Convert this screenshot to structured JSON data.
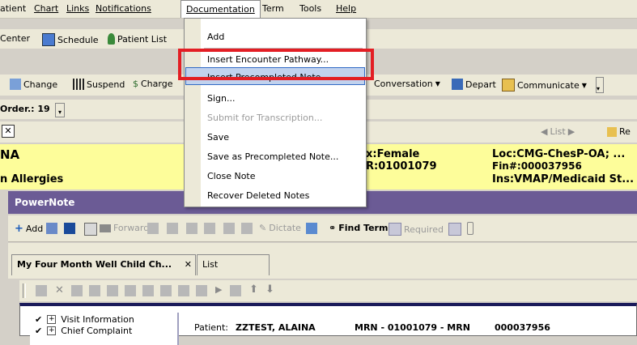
{
  "menubar": {
    "items": [
      "atient",
      "Chart",
      "Links",
      "Notifications",
      "Documentation",
      "Term",
      "Tools",
      "Help"
    ]
  },
  "toolbar1": {
    "center": "Center",
    "schedule": "Schedule",
    "patient_list": "Patient List"
  },
  "toolbar2": {
    "change": "Change",
    "suspend": "Suspend",
    "charges": "Charge",
    "conversation": "Conversation",
    "depart": "Depart",
    "communicate": "Communicate",
    "drop_arrow": "▾"
  },
  "order": {
    "label": "Order.: 19"
  },
  "nav": {
    "close": "✕",
    "list": "List",
    "re": "Re"
  },
  "banner": {
    "name": "NA",
    "allergies": "n Allergies",
    "sex": "x:Female",
    "mrn": "R:01001079",
    "loc": "Loc:CMG-ChesP-OA; ...",
    "fin": "Fin#:000037956",
    "ins": "Ins:VMAP/Medicaid St..."
  },
  "powernote": {
    "title": "PowerNote"
  },
  "pn_toolbar": {
    "add": "Add",
    "forward": "Forward",
    "dictate": "Dictate",
    "find_term": "Find Term",
    "required": "Required"
  },
  "tabs": [
    {
      "label": "My Four Month Well Child Ch...",
      "close": "✕"
    },
    {
      "label": "List"
    }
  ],
  "tree": {
    "items": [
      "Visit Information",
      "Chief Complaint"
    ]
  },
  "note_header": {
    "patient_label": "Patient:",
    "patient_name": "ZZTEST, ALAINA",
    "mrn": "MRN - 01001079 - MRN",
    "fin": "000037956"
  },
  "documentation_menu": {
    "items": [
      {
        "label": "Add",
        "enabled": true
      },
      {
        "label": "Insert Encounter Pathway...",
        "enabled": true
      },
      {
        "label": "Insert Precompleted Note...",
        "enabled": true,
        "highlighted": true
      },
      {
        "label": "Sign...",
        "enabled": true
      },
      {
        "label": "Submit for Transcription...",
        "enabled": false
      },
      {
        "label": "Save",
        "enabled": true
      },
      {
        "label": "Save as Precompleted Note...",
        "enabled": true
      },
      {
        "label": "Close Note",
        "enabled": true
      },
      {
        "label": "Recover Deleted Notes",
        "enabled": true
      }
    ]
  },
  "colors": {
    "banner": "#fdfd9a",
    "powernote_title": "#6b5b95",
    "highlight": "#c1d2ee",
    "callout": "#e31e24"
  }
}
